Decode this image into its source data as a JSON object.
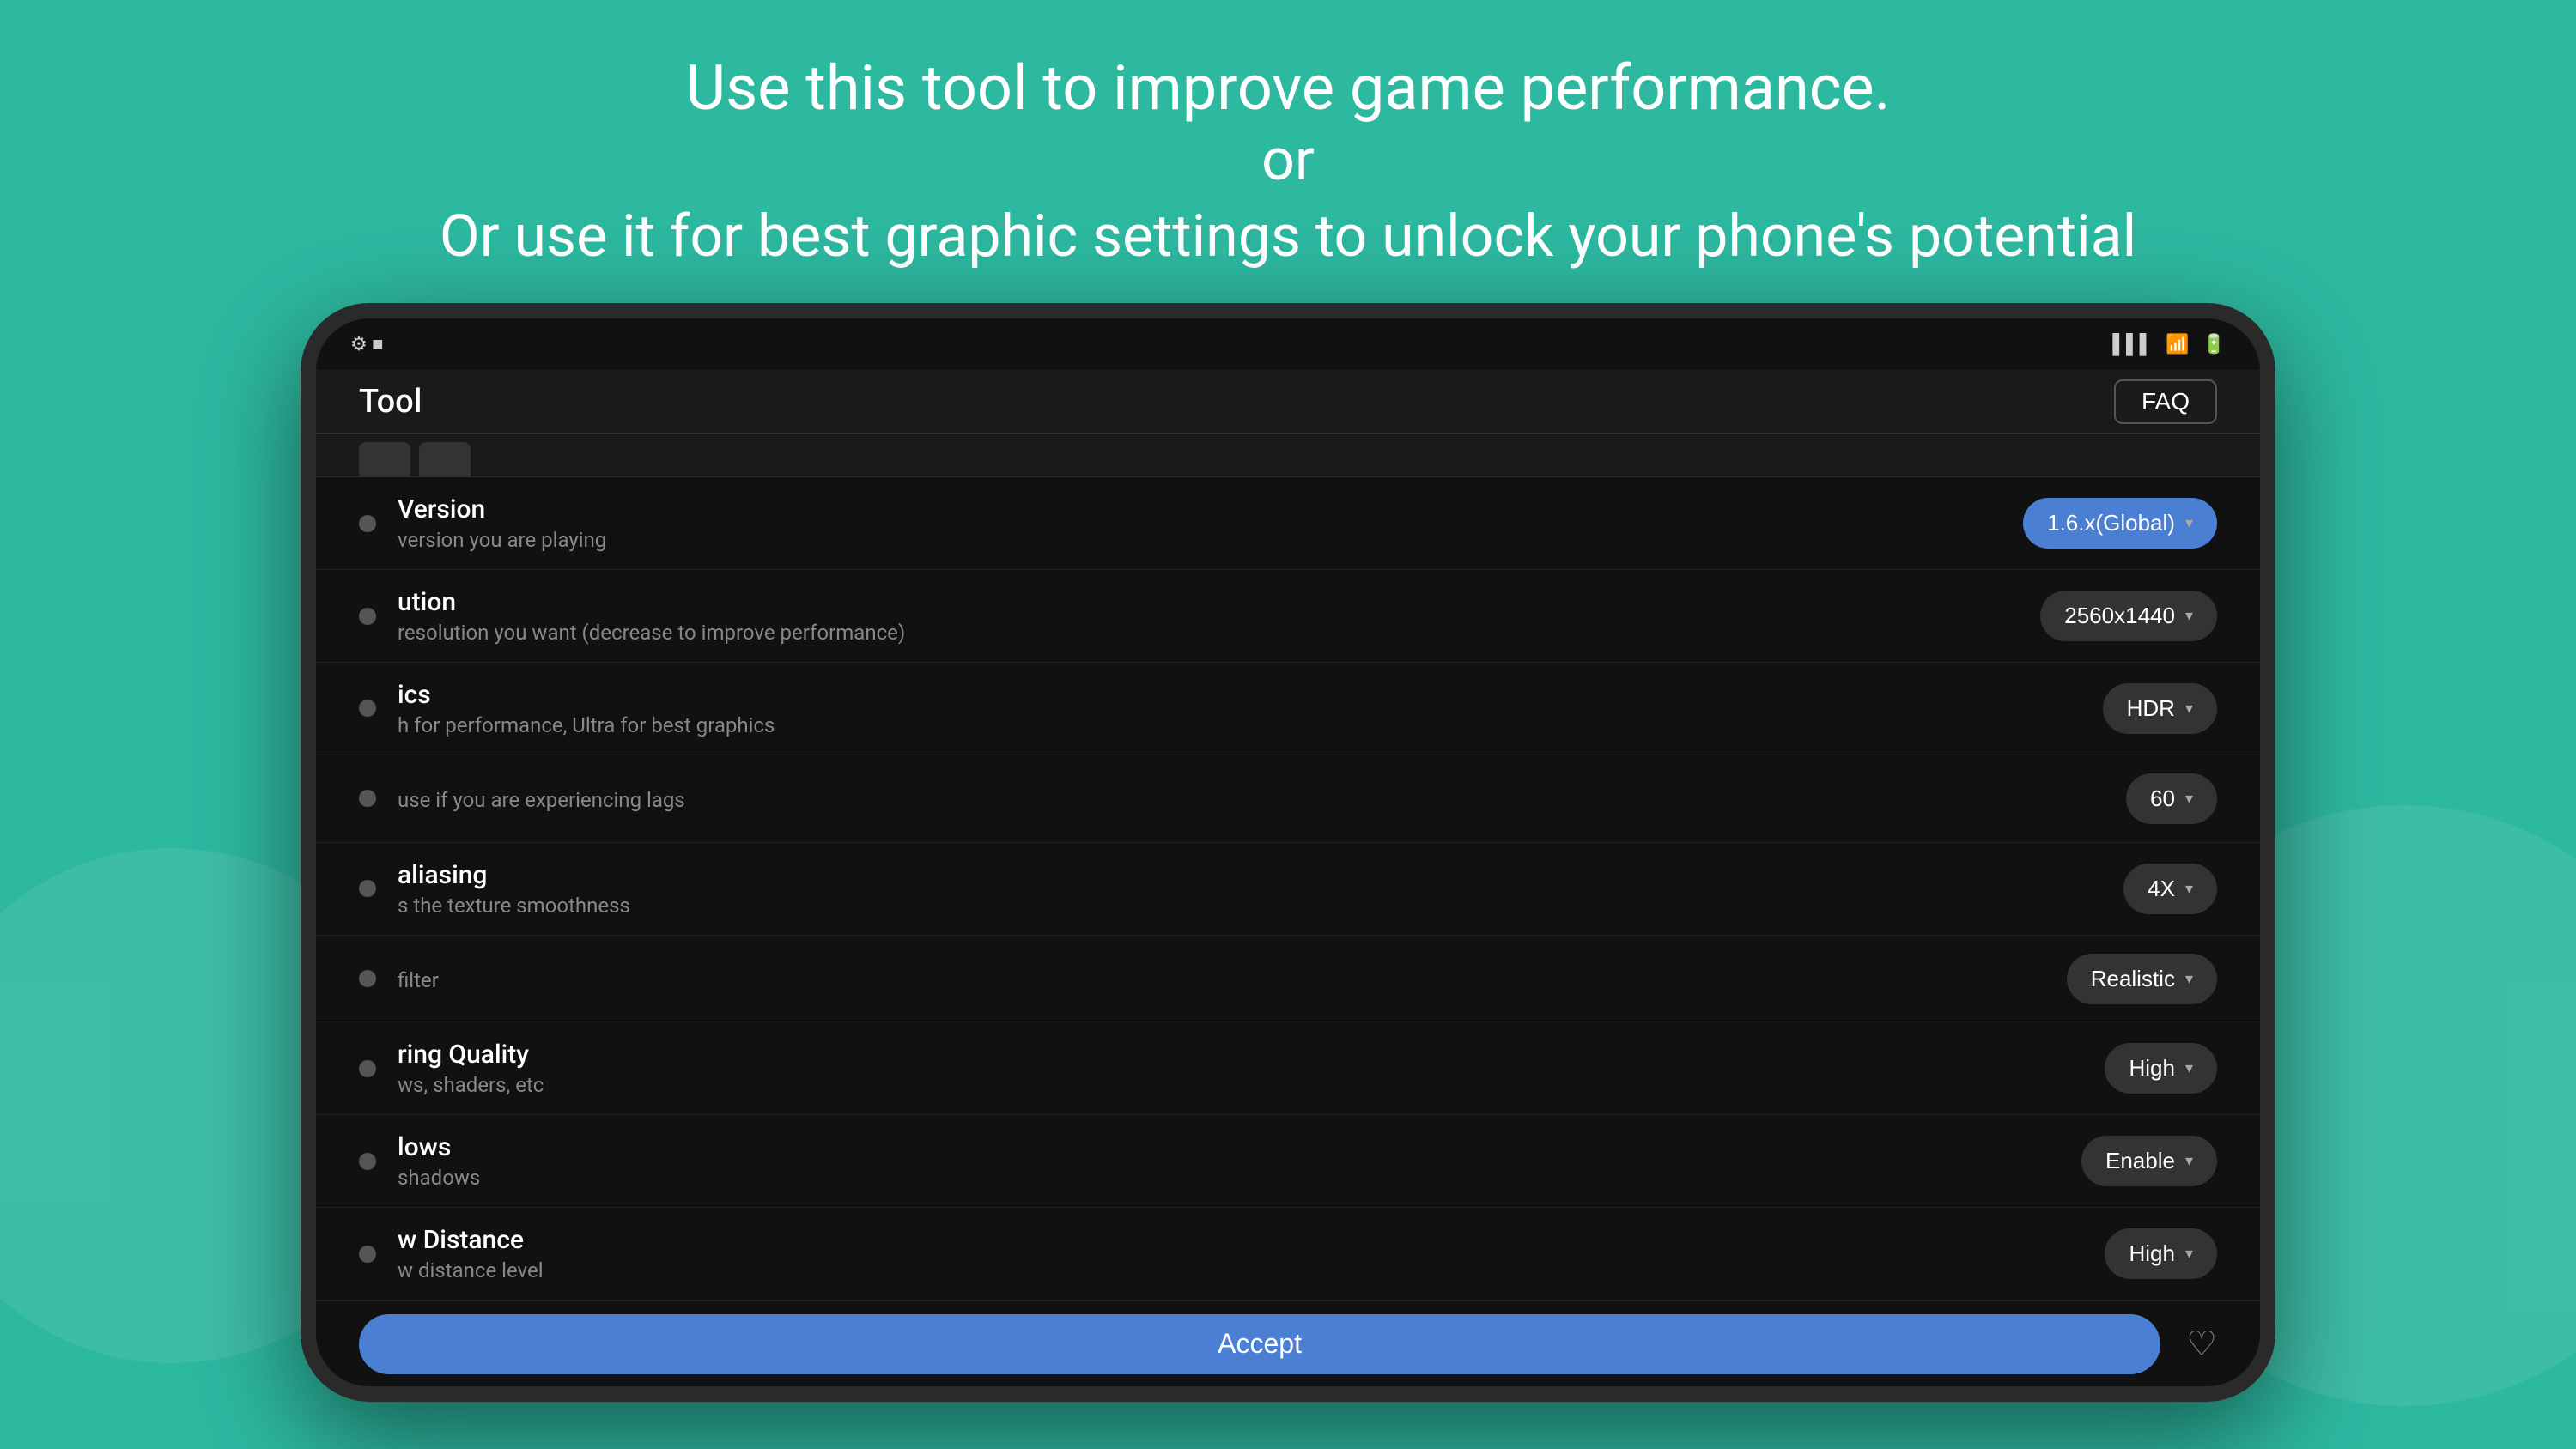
{
  "background": {
    "color": "#2db8a0"
  },
  "header": {
    "line1": "Use this tool to improve game performance.",
    "line2": "or",
    "line3": "Or use it for best graphic settings to unlock your phone's potential"
  },
  "device": {
    "status_bar": {
      "left_icons": "⚙ ■",
      "right_icons": "▌▌▌  📶  🔋"
    },
    "app_header": {
      "title": "Tool",
      "faq_label": "FAQ"
    },
    "tabs": [
      {
        "label": "——"
      },
      {
        "label": "——"
      }
    ],
    "settings": [
      {
        "label": "Version",
        "desc": "version you are playing",
        "value": "1.6.x(Global)",
        "style": "blue"
      },
      {
        "label": "ution",
        "desc": "resolution you want (decrease to improve performance)",
        "value": "2560x1440",
        "style": "gray"
      },
      {
        "label": "ics",
        "desc": "h for performance, Ultra for best graphics",
        "value": "HDR",
        "style": "gray"
      },
      {
        "label": "",
        "desc": "use if you are experiencing lags",
        "value": "60",
        "style": "gray"
      },
      {
        "label": "aliasing",
        "desc": "s the texture smoothness",
        "value": "4X",
        "style": "gray"
      },
      {
        "label": "",
        "desc": "filter",
        "value": "Realistic",
        "style": "gray"
      },
      {
        "label": "ring Quality",
        "desc": "ws, shaders, etc",
        "value": "High",
        "style": "gray"
      },
      {
        "label": "lows",
        "desc": "shadows",
        "value": "Enable",
        "style": "gray"
      },
      {
        "label": "w Distance",
        "desc": "w distance level",
        "value": "High",
        "style": "gray"
      }
    ],
    "footer": {
      "accept_label": "Accept"
    }
  }
}
